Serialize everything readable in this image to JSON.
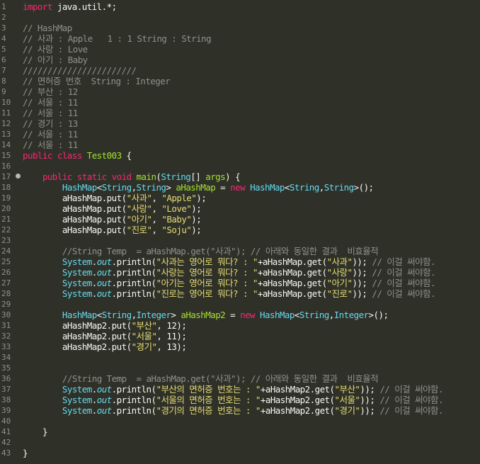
{
  "editor": {
    "language": "Java",
    "file_class": "Test003",
    "lines": [
      {
        "n": "1",
        "text": "import java.util.*;"
      },
      {
        "n": "2",
        "text": ""
      },
      {
        "n": "3",
        "text": "// HashMap"
      },
      {
        "n": "4",
        "text": "// 사과 : Apple   1 : 1 String : String"
      },
      {
        "n": "5",
        "text": "// 사랑 : Love"
      },
      {
        "n": "6",
        "text": "// 아기 : Baby"
      },
      {
        "n": "7",
        "text": "///////////////////////"
      },
      {
        "n": "8",
        "text": "// 면허증 번호  String : Integer"
      },
      {
        "n": "9",
        "text": "// 부산 : 12"
      },
      {
        "n": "10",
        "text": "// 서울 : 11"
      },
      {
        "n": "11",
        "text": "// 서울 : 11"
      },
      {
        "n": "12",
        "text": "// 경기 : 13"
      },
      {
        "n": "13",
        "text": "// 서울 : 11"
      },
      {
        "n": "14",
        "text": "// 서울 : 11"
      },
      {
        "n": "15",
        "text": "public class Test003 {"
      },
      {
        "n": "16",
        "text": ""
      },
      {
        "n": "17",
        "text": "    public static void main(String[] args) {"
      },
      {
        "n": "18",
        "text": "        HashMap<String,String> aHashMap = new HashMap<String,String>();"
      },
      {
        "n": "19",
        "text": "        aHashMap.put(\"사과\", \"Apple\");"
      },
      {
        "n": "20",
        "text": "        aHashMap.put(\"사랑\", \"Love\");"
      },
      {
        "n": "21",
        "text": "        aHashMap.put(\"아기\", \"Baby\");"
      },
      {
        "n": "22",
        "text": "        aHashMap.put(\"진로\", \"Soju\");"
      },
      {
        "n": "23",
        "text": ""
      },
      {
        "n": "24",
        "text": "        //String Temp  = aHashMap.get(\"사과\"); // 아래와 동일한 결과  비효율적"
      },
      {
        "n": "25",
        "text": "        System.out.println(\"사과는 영어로 뭐다? : \"+aHashMap.get(\"사과\")); // 이걸 써야함."
      },
      {
        "n": "26",
        "text": "        System.out.println(\"사랑는 영어로 뭐다? : \"+aHashMap.get(\"사랑\")); // 이걸 써야함."
      },
      {
        "n": "27",
        "text": "        System.out.println(\"아기는 영어로 뭐다? : \"+aHashMap.get(\"아기\")); // 이걸 써야함."
      },
      {
        "n": "28",
        "text": "        System.out.println(\"진로는 영어로 뭐다? : \"+aHashMap.get(\"진로\")); // 이걸 써야함."
      },
      {
        "n": "29",
        "text": ""
      },
      {
        "n": "30",
        "text": "        HashMap<String,Integer> aHashMap2 = new HashMap<String,Integer>();"
      },
      {
        "n": "31",
        "text": "        aHashMap2.put(\"부산\", 12);"
      },
      {
        "n": "32",
        "text": "        aHashMap2.put(\"서울\", 11);"
      },
      {
        "n": "33",
        "text": "        aHashMap2.put(\"경기\", 13);"
      },
      {
        "n": "34",
        "text": ""
      },
      {
        "n": "35",
        "text": ""
      },
      {
        "n": "36",
        "text": "        //String Temp  = aHashMap.get(\"사과\"); // 아래와 동일한 결과  비효율적"
      },
      {
        "n": "37",
        "text": "        System.out.println(\"부산의 면허증 번호는 : \"+aHashMap2.get(\"부산\")); // 이걸 써야함."
      },
      {
        "n": "38",
        "text": "        System.out.println(\"서울의 면허증 번호는 : \"+aHashMap2.get(\"서울\")); // 이걸 써야함."
      },
      {
        "n": "39",
        "text": "        System.out.println(\"경기의 면허증 번호는 : \"+aHashMap2.get(\"경기\")); // 이걸 써야함."
      },
      {
        "n": "40",
        "text": ""
      },
      {
        "n": "41",
        "text": "    }"
      },
      {
        "n": "42",
        "text": ""
      },
      {
        "n": "43",
        "text": "}"
      }
    ]
  },
  "colors": {
    "background": "#2f3129",
    "keyword": "#f92672",
    "type": "#66d9ef",
    "string": "#e6db74",
    "comment": "#8f908a"
  }
}
